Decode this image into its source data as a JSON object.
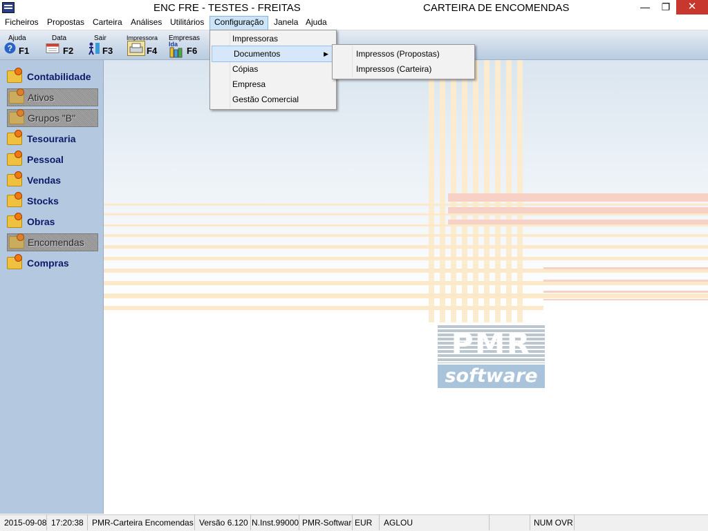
{
  "window": {
    "title_left": "ENC FRE - TESTES - FREITAS",
    "title_right": "CARTEIRA DE ENCOMENDAS",
    "minimize": "—",
    "maximize": "❐",
    "close": "✕"
  },
  "menubar": {
    "items": [
      "Ficheiros",
      "Propostas",
      "Carteira",
      "Análises",
      "Utilitários",
      "Configuração",
      "Janela",
      "Ajuda"
    ],
    "active": "Configuração"
  },
  "toolbar": {
    "buttons": [
      {
        "label": "Ajuda",
        "key": "F1",
        "icon": "help-icon"
      },
      {
        "label": "Data",
        "key": "F2",
        "icon": "calendar-icon"
      },
      {
        "label": "Sair",
        "key": "F3",
        "icon": "exit-icon"
      },
      {
        "label": "Impressora",
        "key": "F4",
        "icon": "printer-icon"
      },
      {
        "label": "Empresas",
        "key": "F6",
        "icon": "companies-icon",
        "sublabel": "Ida"
      }
    ]
  },
  "config_menu": {
    "items": [
      "Impressoras",
      "Documentos",
      "Cópias",
      "Empresa",
      "Gestão Comercial"
    ],
    "highlighted": "Documentos",
    "submenu_arrow": "▶"
  },
  "documentos_submenu": {
    "items": [
      "Impressos (Propostas)",
      "Impressos (Carteira)"
    ]
  },
  "sidebar": {
    "items": [
      {
        "label": "Contabilidade",
        "enabled": true
      },
      {
        "label": "Ativos",
        "enabled": false
      },
      {
        "label": "Grupos \"B\"",
        "enabled": false
      },
      {
        "label": "Tesouraria",
        "enabled": true
      },
      {
        "label": "Pessoal",
        "enabled": true
      },
      {
        "label": "Vendas",
        "enabled": true
      },
      {
        "label": "Stocks",
        "enabled": true
      },
      {
        "label": "Obras",
        "enabled": true
      },
      {
        "label": "Encomendas",
        "enabled": false
      },
      {
        "label": "Compras",
        "enabled": true
      }
    ]
  },
  "logo": {
    "brand": "PMR",
    "word": "software"
  },
  "statusbar": {
    "date": "2015-09-08",
    "time": "17:20:38",
    "app": "PMR-Carteira Encomendas",
    "version": "Versão  6.120",
    "install": "N.Inst.99000",
    "vendor": "PMR-Software",
    "currency": "EUR",
    "user": "AGLOU",
    "empty": "",
    "keys": "NUM OVR"
  },
  "colors": {
    "sidebar_bg": "#b4c9e0",
    "menu_active": "#cce4f7",
    "close_button": "#c7372e",
    "sidebar_text": "#0a1a68"
  }
}
